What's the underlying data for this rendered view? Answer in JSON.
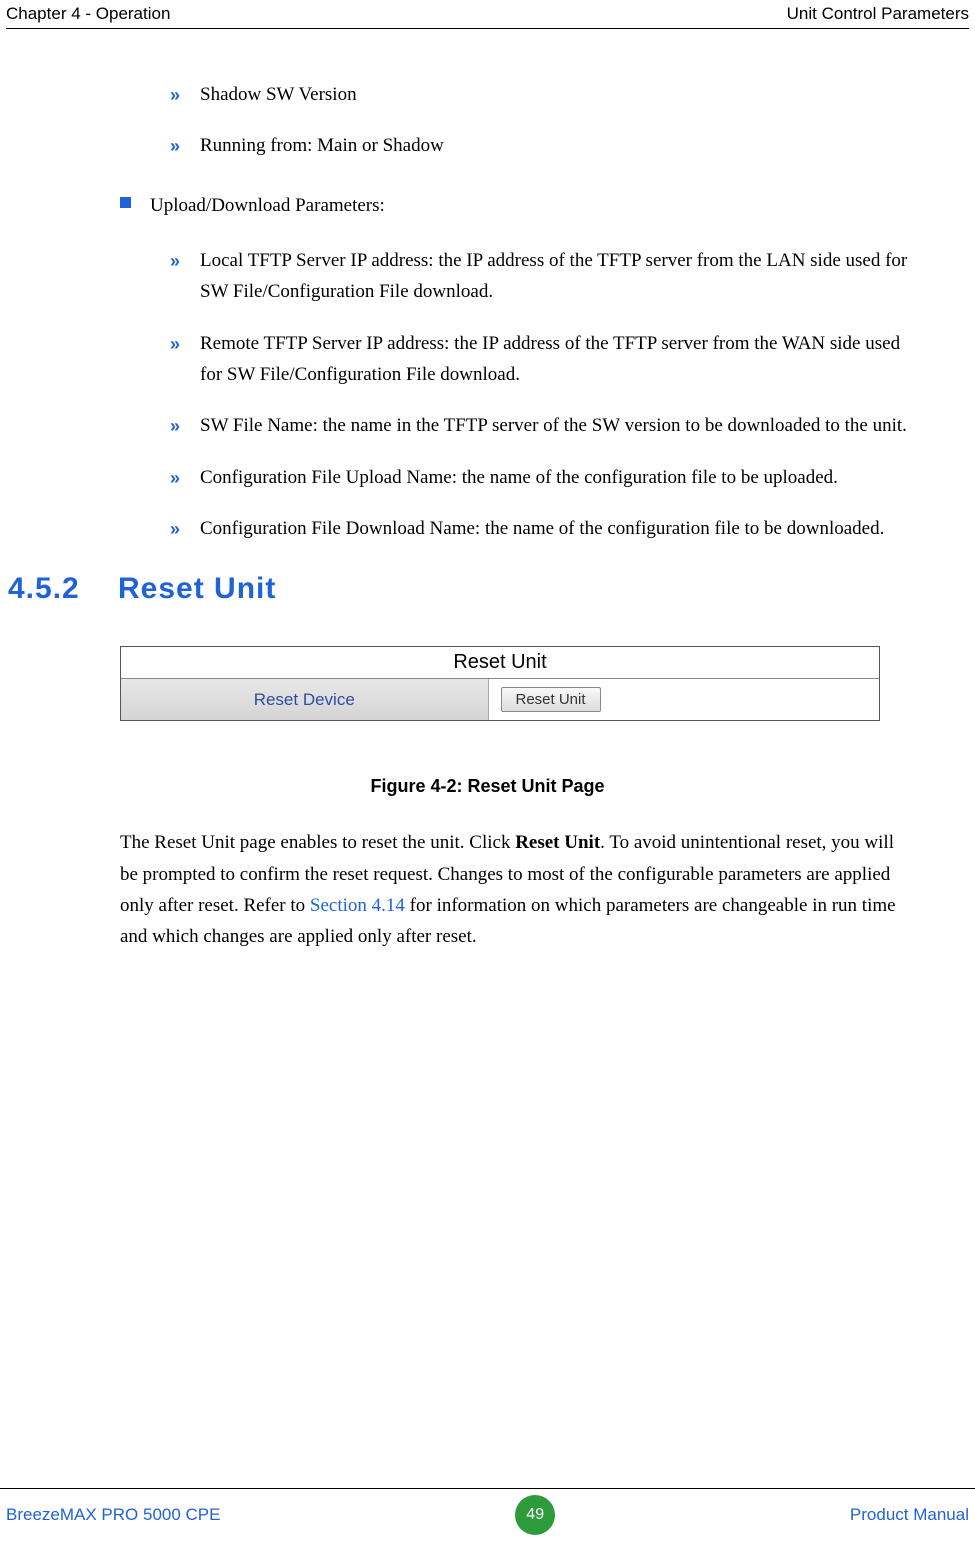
{
  "header": {
    "left": "Chapter 4 - Operation",
    "right": "Unit Control Parameters"
  },
  "top_list": [
    "Shadow SW Version",
    "Running from: Main or Shadow"
  ],
  "upload_section": {
    "title": "Upload/Download Parameters:",
    "items": [
      "Local TFTP Server IP address: the IP address of the TFTP server from the LAN side used for SW File/Configuration File download.",
      "Remote TFTP Server IP address: the IP address of the TFTP server from the WAN side used for SW File/Configuration File download.",
      "SW File Name: the name in the TFTP server of the SW version to be downloaded to the unit.",
      "Configuration File Upload Name: the name of the configuration file to be uploaded.",
      "Configuration File Download Name: the name of the configuration file to be downloaded."
    ]
  },
  "section": {
    "number": "4.5.2",
    "title": "Reset Unit"
  },
  "figure": {
    "panel_title": "Reset Unit",
    "row_label": "Reset Device",
    "button_label": "Reset Unit",
    "caption": "Figure 4-2: Reset Unit Page"
  },
  "paragraph": {
    "pre": "The Reset Unit page enables to reset the unit. Click ",
    "bold": "Reset Unit",
    "mid": ". To avoid unintentional reset, you will be prompted to confirm the reset request. Changes to most of the configurable parameters are applied only after reset. Refer to ",
    "link": "Section 4.14",
    "post": " for information on which parameters are changeable in run time and which changes are applied only after reset."
  },
  "footer": {
    "left": "BreezeMAX PRO 5000 CPE",
    "page": "49",
    "right": "Product Manual"
  }
}
